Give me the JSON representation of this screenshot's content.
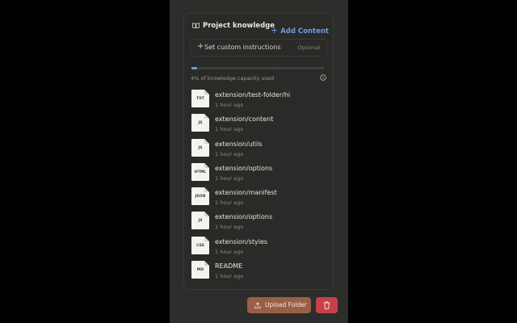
{
  "header": {
    "title": "Project knowledge",
    "add_label": "Add Content"
  },
  "instructions": {
    "label": "Set custom instructions",
    "optional": "Optional"
  },
  "capacity": {
    "percent_used": 4,
    "text": "4% of knowledge capacity used"
  },
  "files": [
    {
      "ext": "TXT",
      "name": "extension/test-folder/hi",
      "time": "1 hour ago"
    },
    {
      "ext": "JS",
      "name": "extension/content",
      "time": "1 hour ago"
    },
    {
      "ext": "JS",
      "name": "extension/utils",
      "time": "1 hour ago"
    },
    {
      "ext": "HTML",
      "name": "extension/options",
      "time": "1 hour ago"
    },
    {
      "ext": "JSON",
      "name": "extension/manifest",
      "time": "1 hour ago"
    },
    {
      "ext": "JS",
      "name": "extension/options",
      "time": "1 hour ago"
    },
    {
      "ext": "CSS",
      "name": "extension/styles",
      "time": "1 hour ago"
    },
    {
      "ext": "MD",
      "name": "README",
      "time": "1 hour ago"
    }
  ],
  "actions": {
    "upload_label": "Upload Folder"
  },
  "colors": {
    "accent": "#6f9be0",
    "upload_bg": "#9a5f47",
    "delete_bg": "#c8414a"
  },
  "icons": {
    "header": "book-icon",
    "info": "info-icon",
    "upload": "upload-icon",
    "delete": "trash-icon",
    "file": "document-icon"
  }
}
